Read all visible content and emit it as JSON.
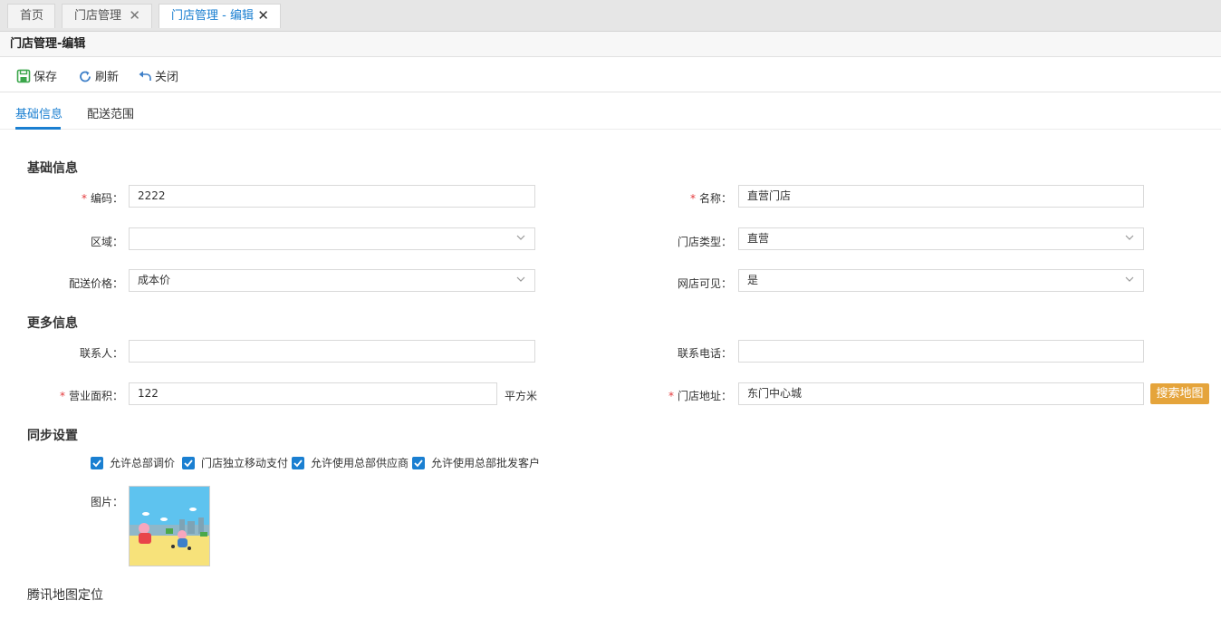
{
  "tabs": [
    {
      "label": "首页",
      "closable": false
    },
    {
      "label": "门店管理",
      "closable": true
    },
    {
      "label": "门店管理 - 编辑",
      "closable": true,
      "active": true
    }
  ],
  "page_title": "门店管理-编辑",
  "toolbar": {
    "save": "保存",
    "refresh": "刷新",
    "close": "关闭"
  },
  "subtabs": [
    {
      "label": "基础信息",
      "active": true
    },
    {
      "label": "配送范围"
    }
  ],
  "sections": {
    "basic": "基础信息",
    "more": "更多信息",
    "sync": "同步设置"
  },
  "fields": {
    "code": {
      "label": "编码：",
      "value": "2222",
      "required": true
    },
    "name": {
      "label": "名称：",
      "value": "直营门店",
      "required": true
    },
    "region": {
      "label": "区域：",
      "value": ""
    },
    "store_type": {
      "label": "门店类型：",
      "value": "直营"
    },
    "delivery_price": {
      "label": "配送价格：",
      "value": "成本价"
    },
    "online_visible": {
      "label": "网店可见：",
      "value": "是"
    },
    "contact": {
      "label": "联系人：",
      "value": ""
    },
    "phone": {
      "label": "联系电话：",
      "value": ""
    },
    "area": {
      "label": "营业面积：",
      "value": "122",
      "unit": "平方米",
      "required": true
    },
    "address": {
      "label": "门店地址：",
      "value": "东门中心城",
      "required": true
    }
  },
  "search_map_button": "搜索地图",
  "checkboxes": [
    {
      "label": "允许总部调价",
      "checked": true
    },
    {
      "label": "门店独立移动支付",
      "checked": true
    },
    {
      "label": "允许使用总部供应商",
      "checked": true
    },
    {
      "label": "允许使用总部批发客户",
      "checked": true
    }
  ],
  "picture_label": "图片：",
  "map_title": "腾讯地图定位",
  "colors": {
    "accent": "#1a7fd1",
    "button_orange": "#e5a43b",
    "required": "#e4393c"
  }
}
